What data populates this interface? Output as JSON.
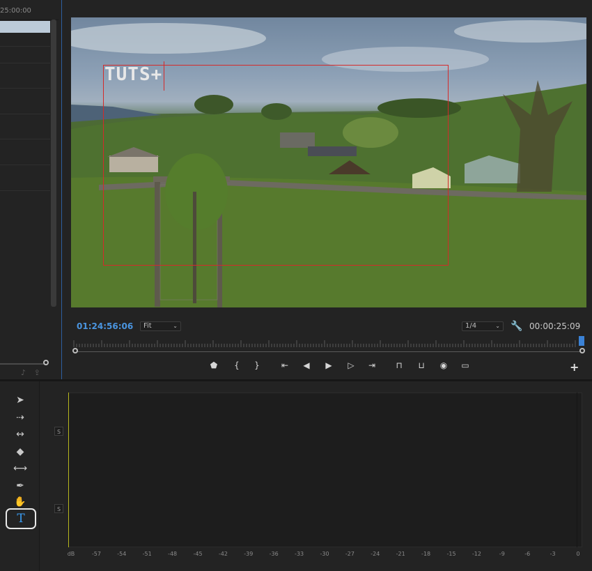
{
  "source_panel": {
    "timecode": "25:00:00",
    "footer_icons": [
      "audio-icon",
      "export-icon"
    ]
  },
  "program_monitor": {
    "title_overlay_text": "TUTS+",
    "current_timecode": "01:24:56:06",
    "zoom_select": "Fit",
    "resolution_select": "1/4",
    "duration_timecode": "00:00:25:09",
    "transport_icons": [
      "marker-icon",
      "in-point-icon",
      "out-point-icon",
      "go-to-in-icon",
      "step-back-icon",
      "play-icon",
      "step-forward-icon",
      "go-to-out-icon",
      "lift-icon",
      "extract-icon",
      "export-frame-icon",
      "comparison-view-icon"
    ]
  },
  "tools": [
    {
      "name": "selection-tool-icon",
      "glyph": "➤"
    },
    {
      "name": "track-select-tool-icon",
      "glyph": "⇢"
    },
    {
      "name": "ripple-edit-tool-icon",
      "glyph": "↔"
    },
    {
      "name": "razor-tool-icon",
      "glyph": "◆"
    },
    {
      "name": "slip-tool-icon",
      "glyph": "⟷"
    },
    {
      "name": "pen-tool-icon",
      "glyph": "✒"
    },
    {
      "name": "hand-tool-icon",
      "glyph": "✋"
    }
  ],
  "type_tool": {
    "glyph": "T"
  },
  "audio_meter": {
    "solo_label": "S",
    "scale": [
      "dB",
      "-57",
      "-54",
      "-51",
      "-48",
      "-45",
      "-42",
      "-39",
      "-36",
      "-33",
      "-30",
      "-27",
      "-24",
      "-21",
      "-18",
      "-15",
      "-12",
      "-9",
      "-6",
      "-3",
      "0"
    ]
  },
  "colors": {
    "accent_blue": "#3b82d6",
    "timecode_blue": "#4a95e0",
    "safe_margin_red": "#d42a2a"
  }
}
